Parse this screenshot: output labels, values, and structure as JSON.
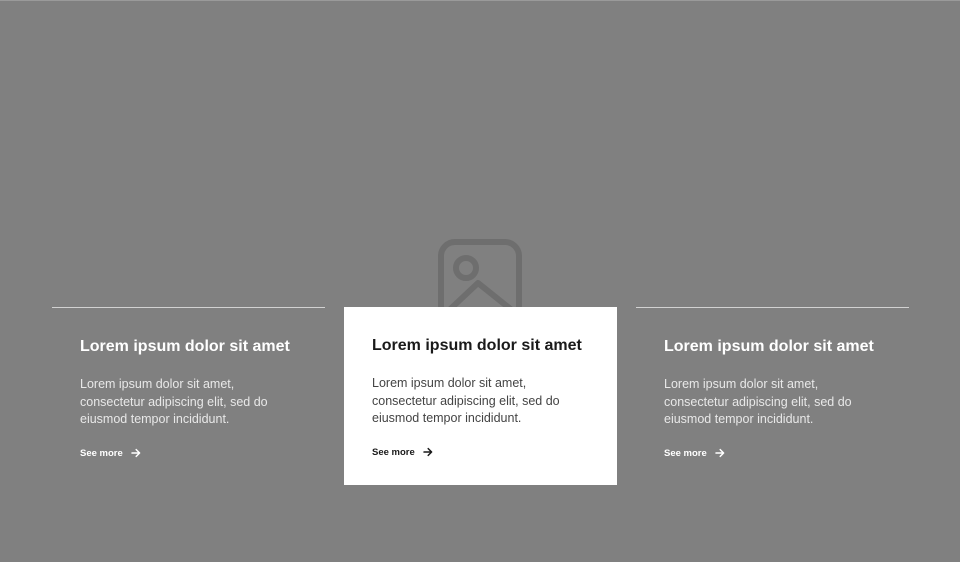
{
  "hero": {
    "placeholder_icon": "image-placeholder-icon",
    "background_color": "#808080"
  },
  "cards": [
    {
      "title": "Lorem ipsum dolor sit amet",
      "body": "Lorem ipsum dolor sit amet, consectetur adipiscing elit, sed do eiusmod tempor incididunt.",
      "link_label": "See more",
      "link_icon": "arrow-right-icon",
      "active": false
    },
    {
      "title": "Lorem ipsum dolor sit amet",
      "body": "Lorem ipsum dolor sit amet, consectetur adipiscing elit, sed do eiusmod tempor incididunt.",
      "link_label": "See more",
      "link_icon": "arrow-right-icon",
      "active": true
    },
    {
      "title": "Lorem ipsum dolor sit amet",
      "body": "Lorem ipsum dolor sit amet, consectetur adipiscing elit, sed do eiusmod tempor incididunt.",
      "link_label": "See more",
      "link_icon": "arrow-right-icon",
      "active": false
    }
  ],
  "colors": {
    "active_card_bg": "#ffffff",
    "text_dark": "#1a1a1a",
    "text_light": "#ffffff"
  }
}
